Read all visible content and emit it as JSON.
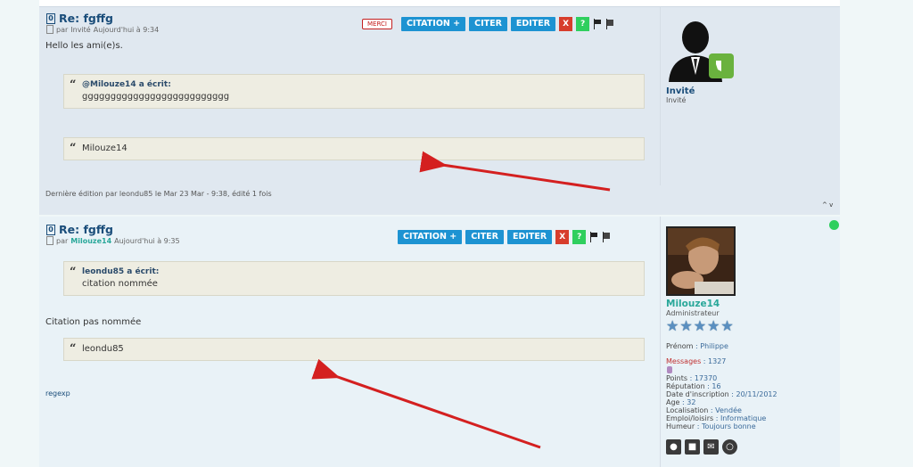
{
  "post1": {
    "num": "0",
    "title": "Re: fgffg",
    "meta_prefix": "par",
    "author": "Invité",
    "date": "Aujourd'hui à 9:34",
    "toolbar": {
      "merci": "MERCI",
      "citation_plus": "CITATION +",
      "citer": "CITER",
      "editer": "EDITER",
      "delete": "X",
      "help": "?"
    },
    "body": "Hello les ami(e)s.",
    "quotes": [
      {
        "author": "@Milouze14 a écrit:",
        "text": "gggggggggggggggggggggggggg"
      },
      {
        "author": "",
        "text": "Milouze14"
      }
    ],
    "edit_note": "Dernière édition par leondu85 le Mar 23 Mar - 9:38, édité 1 fois",
    "nav_arrows": "^ v",
    "user": {
      "name": "Invité",
      "rank": "Invité"
    }
  },
  "post2": {
    "num": "0",
    "title": "Re: fgffg",
    "meta_prefix": "par",
    "author": "Milouze14",
    "date": "Aujourd'hui à 9:35",
    "toolbar": {
      "citation_plus": "CITATION +",
      "citer": "CITER",
      "editer": "EDITER",
      "delete": "X",
      "help": "?"
    },
    "quotes": [
      {
        "author": "leondu85 a écrit:",
        "text": "citation nommée"
      },
      {
        "author": "",
        "text": "leondu85"
      }
    ],
    "body": "Citation pas nommée",
    "signature": "regexp",
    "user": {
      "name": "Milouze14",
      "rank": "Administrateur",
      "stars": 5,
      "fields": [
        {
          "key": "Prénom",
          "value": "Philippe"
        },
        {
          "key": "Messages",
          "value": "1327"
        },
        {
          "key": "Points",
          "value": "17370"
        },
        {
          "key": "Réputation",
          "value": "16"
        },
        {
          "key": "Date d'inscription",
          "value": "20/11/2012"
        },
        {
          "key": "Age",
          "value": "32"
        },
        {
          "key": "Localisation",
          "value": "Vendée"
        },
        {
          "key": "Emploi/loisirs",
          "value": "Informatique"
        },
        {
          "key": "Humeur",
          "value": "Toujours bonne"
        }
      ],
      "online_color": "#2fcf5e"
    }
  },
  "colors": {
    "accent_button": "#1d93d2",
    "delete": "#d73d2c",
    "help": "#2fcf5e",
    "title": "#1a4d7a",
    "arrow": "#d42020"
  }
}
